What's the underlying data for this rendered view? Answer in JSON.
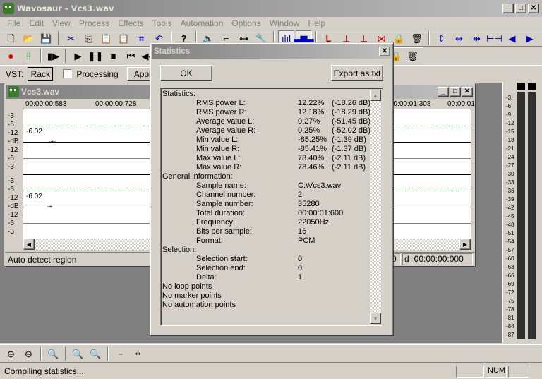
{
  "app": {
    "title": "Wavosaur - Vcs3.wav",
    "window_controls": {
      "minimize": "_",
      "maximize": "□",
      "close": "✕"
    }
  },
  "menu": [
    "File",
    "Edit",
    "View",
    "Process",
    "Effects",
    "Tools",
    "Automation",
    "Options",
    "Window",
    "Help"
  ],
  "toolbar1": {
    "file_icons": [
      "new-file-icon",
      "open-folder-icon",
      "save-icon"
    ],
    "edit_icons": [
      "cut-icon",
      "copy-icon",
      "paste-icon",
      "paste-new-icon",
      "crop-icon",
      "undo-icon"
    ],
    "help_icon": "help-icon",
    "tool_icons": [
      "speaker-icon",
      "envelope-icon",
      "routing-icon",
      "wrench-icon",
      "waveform-view-icon",
      "spectrum-view-icon"
    ],
    "loop_icons": [
      "loop-start-icon",
      "loop-start-left-icon",
      "loop-start-right-icon",
      "loop-region-icon",
      "lock-icon",
      "trash-icon"
    ],
    "nav_icons": [
      "zoom-region-icon",
      "snap-left-icon",
      "snap-right-icon",
      "select-range-icon",
      "previous-icon",
      "next-icon"
    ]
  },
  "transport": {
    "icons": [
      "record-icon",
      "meter-icon",
      "play-from-start-icon",
      "play-icon",
      "pause-icon",
      "stop-icon",
      "skip-start-icon",
      "rewind-icon"
    ]
  },
  "vst": {
    "label": "VST:",
    "rack_button": "Rack",
    "processing_label": "Processing",
    "processing_checked": false,
    "apply_button": "Apply"
  },
  "document": {
    "title": "Vcs3.wav",
    "timeline": [
      "00:00:00:583",
      "00:00:00:728",
      "00:00:01:308",
      "00:00:01"
    ],
    "channels": [
      {
        "db_labels": [
          "-3",
          "-6",
          "-12",
          "-dB",
          "-12",
          "-6",
          "-3"
        ],
        "peak_label": "-6.02"
      },
      {
        "db_labels": [
          "-3",
          "-6",
          "-12",
          "-dB",
          "-12",
          "-6",
          "-3"
        ],
        "peak_label": "-6.02"
      }
    ],
    "status_left": "Auto detect region",
    "status_position": "0",
    "status_delta": "d=00:00:00:000"
  },
  "dialog": {
    "title": "Statistics",
    "ok_button": "OK",
    "export_button": "Export as txt",
    "lines": [
      {
        "label": "Statistics:",
        "indent": false
      },
      {
        "label": "RMS power L:",
        "value": "12.22%",
        "db": "(-18.26 dB)",
        "indent": true
      },
      {
        "label": "RMS power R:",
        "value": "12.18%",
        "db": "(-18.29 dB)",
        "indent": true
      },
      {
        "label": "Average value L:",
        "value": "0.27%",
        "db": "(-51.45 dB)",
        "indent": true
      },
      {
        "label": "Average value R:",
        "value": "0.25%",
        "db": "(-52.02 dB)",
        "indent": true
      },
      {
        "label": "Min value L:",
        "value": "-85.25%",
        "db": "(-1.39 dB)",
        "indent": true
      },
      {
        "label": "Min value R:",
        "value": "-85.41%",
        "db": "(-1.37 dB)",
        "indent": true
      },
      {
        "label": "Max value L:",
        "value": "78.40%",
        "db": "(-2.11 dB)",
        "indent": true
      },
      {
        "label": "Max value R:",
        "value": "78.46%",
        "db": "(-2.11 dB)",
        "indent": true
      },
      {
        "label": "General information:",
        "indent": false
      },
      {
        "label": "Sample name:",
        "value": "C:\\Vcs3.wav",
        "indent": true
      },
      {
        "label": "Channel number:",
        "value": "2",
        "indent": true
      },
      {
        "label": "Sample number:",
        "value": "35280",
        "indent": true
      },
      {
        "label": "Total duration:",
        "value": "00:00:01:600",
        "indent": true
      },
      {
        "label": "Frequency:",
        "value": "22050Hz",
        "indent": true
      },
      {
        "label": "Bits per sample:",
        "value": "16",
        "indent": true
      },
      {
        "label": "Format:",
        "value": "PCM",
        "indent": true
      },
      {
        "label": "Selection:",
        "indent": false
      },
      {
        "label": "Selection start:",
        "value": "0",
        "indent": true
      },
      {
        "label": "Selection end:",
        "value": "0",
        "indent": true
      },
      {
        "label": "Delta:",
        "value": "1",
        "indent": true
      },
      {
        "label": "No loop points",
        "indent": false
      },
      {
        "label": "No marker points",
        "indent": false
      },
      {
        "label": "No automation points",
        "indent": false
      }
    ]
  },
  "meter": {
    "scale": [
      "-3",
      "-6",
      "-9",
      "-12",
      "-15",
      "-18",
      "-21",
      "-24",
      "-27",
      "-30",
      "-33",
      "-36",
      "-39",
      "-42",
      "-45",
      "-48",
      "-51",
      "-54",
      "-57",
      "-60",
      "-63",
      "-66",
      "-69",
      "-72",
      "-75",
      "-78",
      "-81",
      "-84",
      "-87"
    ]
  },
  "zoom_toolbar": {
    "icons": [
      "zoom-in-icon",
      "zoom-out-icon",
      "zoom-selection-icon",
      "zoom-in-vertical-icon",
      "zoom-out-vertical-icon",
      "double-zoom-icon",
      "half-zoom-icon"
    ]
  },
  "statusbar": {
    "text": "Compiling statistics...",
    "indicators": [
      "",
      "NUM",
      ""
    ]
  }
}
